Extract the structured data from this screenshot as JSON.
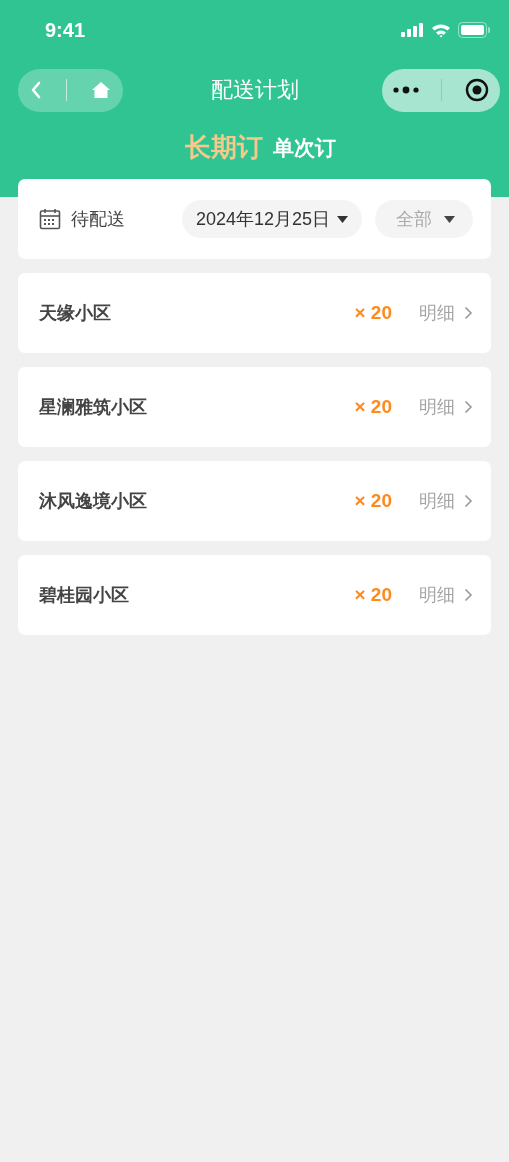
{
  "status_bar": {
    "time": "9:41"
  },
  "nav": {
    "title": "配送计划"
  },
  "tabs": [
    {
      "label": "长期订",
      "selected": true
    },
    {
      "label": "单次订",
      "selected": false
    }
  ],
  "filter": {
    "status": "待配送",
    "date": "2024年12月25日",
    "scope": "全部"
  },
  "rows": [
    {
      "name": "天缘小区",
      "count": "× 20",
      "link": "明细"
    },
    {
      "name": "星澜雅筑小区",
      "count": "× 20",
      "link": "明细"
    },
    {
      "name": "沐风逸境小区",
      "count": "× 20",
      "link": "明细"
    },
    {
      "name": "碧桂园小区",
      "count": "× 20",
      "link": "明细"
    }
  ]
}
